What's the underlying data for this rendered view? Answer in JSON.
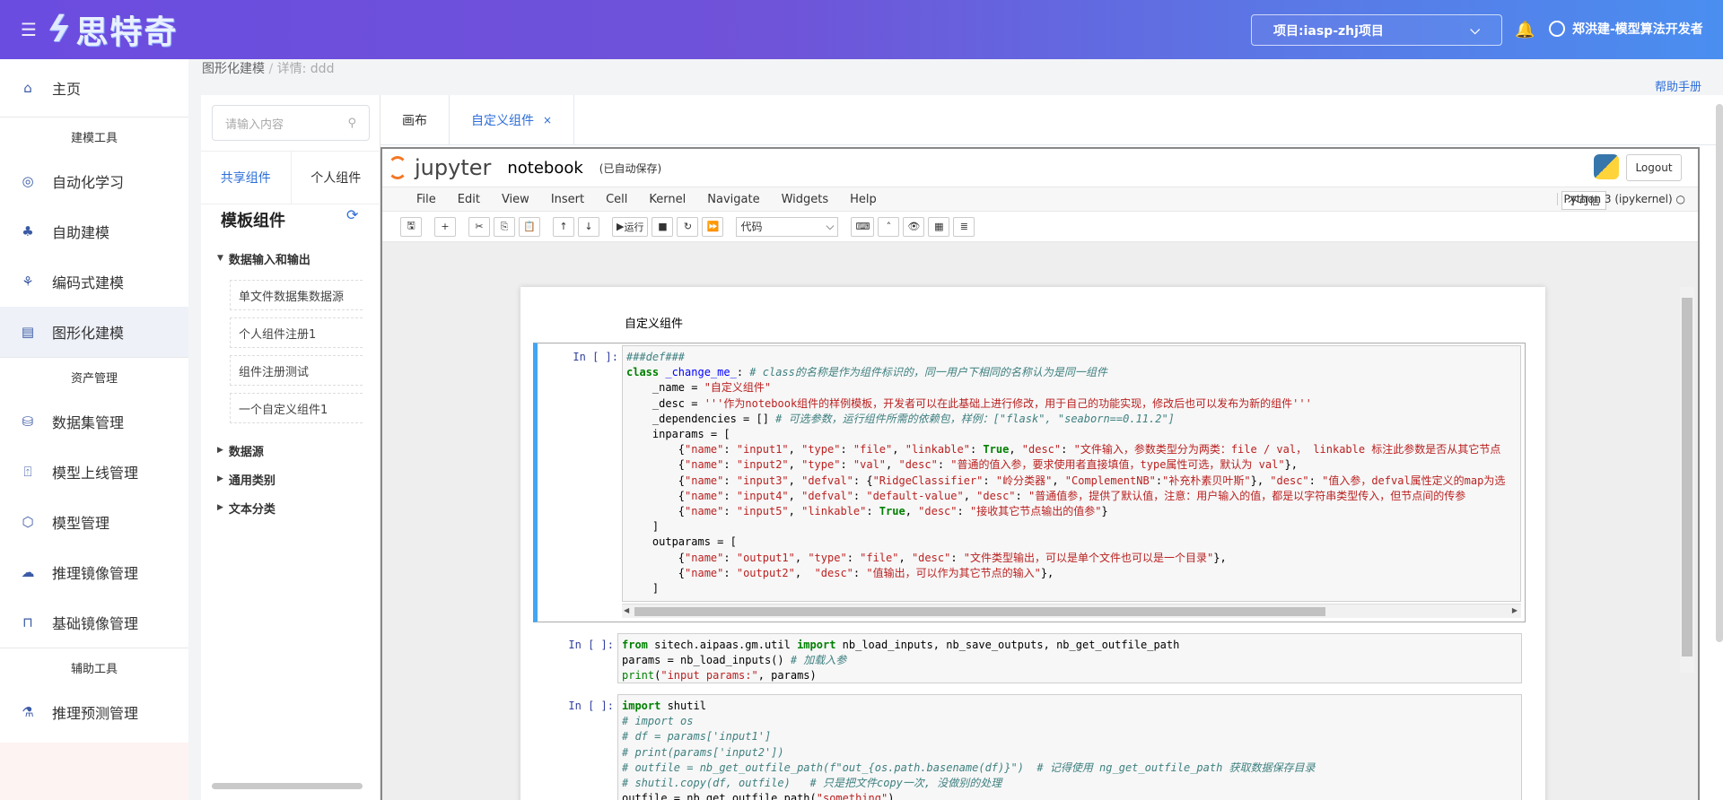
{
  "topbar": {
    "brand": "思特奇",
    "project": "项目:iasp-zhj项目",
    "user": "郑洪建-模型算法开发者"
  },
  "sidebar": {
    "home": "主页",
    "groups": [
      "建模工具",
      "资产管理",
      "辅助工具"
    ],
    "items1": [
      "自动化学习",
      "自助建模",
      "编码式建模",
      "图形化建模"
    ],
    "items2": [
      "数据集管理",
      "模型上线管理",
      "模型管理",
      "推理镜像管理",
      "基础镜像管理"
    ],
    "items3": [
      "推理预测管理"
    ]
  },
  "breadcrumb": {
    "root": "图形化建模",
    "sep": "/",
    "current": "详情: ddd"
  },
  "help": "帮助手册",
  "panel": {
    "search_placeholder": "请输入内容",
    "tabs": [
      "共享组件",
      "个人组件"
    ],
    "title": "模板组件",
    "tree": {
      "group1": "数据输入和输出",
      "leaves": [
        "单文件数据集数据源",
        "个人组件注册1",
        "组件注册测试",
        "一个自定义组件1"
      ],
      "others": [
        "数据源",
        "通用类别",
        "文本分类"
      ]
    }
  },
  "tabs": {
    "canvas": "画布",
    "custom": "自定义组件",
    "close": "×"
  },
  "jupyter": {
    "logo": "jupyter",
    "name": "notebook",
    "saved": "(已自动保存)",
    "logout": "Logout",
    "menu": [
      "File",
      "Edit",
      "View",
      "Insert",
      "Cell",
      "Kernel",
      "Navigate",
      "Widgets",
      "Help"
    ],
    "trusted": "不可信",
    "kernel": "Python 3 (ipykernel)",
    "run": "运行",
    "celltype": "代码",
    "md_text": "自定义组件",
    "prompt": "In  [  ]:"
  }
}
